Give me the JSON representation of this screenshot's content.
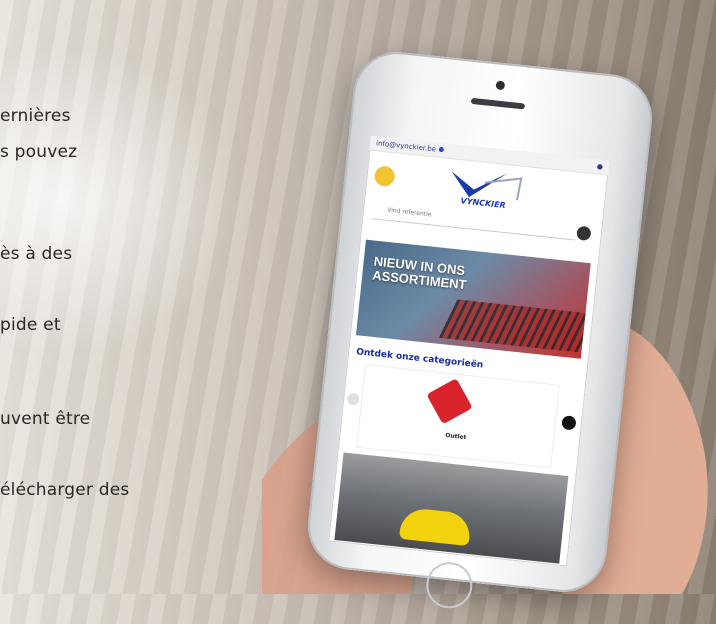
{
  "text_lines": [
    "ernières",
    "s pouvez",
    "ès à des",
    "pide et",
    "uvent être",
    "élécharger des"
  ],
  "phone": {
    "status_left": "info@vynckier.be",
    "search_placeholder": "Vind referentie",
    "logo_text": "VYNCKIER",
    "banner_line1": "NIEUW IN ONS",
    "banner_line2": "ASSORTIMENT",
    "section_title": "Ontdek onze categorieën",
    "category_label": "Outlet"
  }
}
